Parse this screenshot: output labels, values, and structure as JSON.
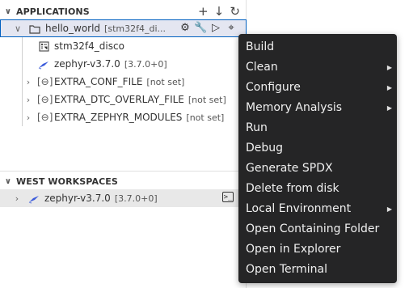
{
  "applications": {
    "header": "APPLICATIONS",
    "actions": {
      "add": "+",
      "download": "↓",
      "refresh": "↻"
    },
    "items": [
      {
        "label": "hello_world",
        "desc": "[stm32f4_di..."
      },
      {
        "label": "stm32f4_disco",
        "desc": ""
      },
      {
        "label": "zephyr-v3.7.0",
        "desc": "[3.7.0+0]"
      },
      {
        "label": "EXTRA_CONF_FILE",
        "desc": "[not set]"
      },
      {
        "label": "EXTRA_DTC_OVERLAY_FILE",
        "desc": "[not set]"
      },
      {
        "label": "EXTRA_ZEPHYR_MODULES",
        "desc": "[not set]"
      }
    ]
  },
  "west_workspaces": {
    "header": "WEST WORKSPACES",
    "items": [
      {
        "label": "zephyr-v3.7.0",
        "desc": "[3.7.0+0]"
      }
    ]
  },
  "context_menu": {
    "items": [
      {
        "label": "Build",
        "submenu": false
      },
      {
        "label": "Clean",
        "submenu": true
      },
      {
        "label": "Configure",
        "submenu": true
      },
      {
        "label": "Memory Analysis",
        "submenu": true
      },
      {
        "label": "Run",
        "submenu": false
      },
      {
        "label": "Debug",
        "submenu": false
      },
      {
        "label": "Generate SPDX",
        "submenu": false
      },
      {
        "label": "Delete from disk",
        "submenu": false
      },
      {
        "label": "Local Environment",
        "submenu": true
      },
      {
        "label": "Open Containing Folder",
        "submenu": false
      },
      {
        "label": "Open in Explorer",
        "submenu": false
      },
      {
        "label": "Open Terminal",
        "submenu": false
      }
    ]
  },
  "colors": {
    "menu_bg": "#252526",
    "selection_bg": "#e4e6f1",
    "selection_border": "#0060c0",
    "zephyr_icon": "#3b5bdb"
  }
}
